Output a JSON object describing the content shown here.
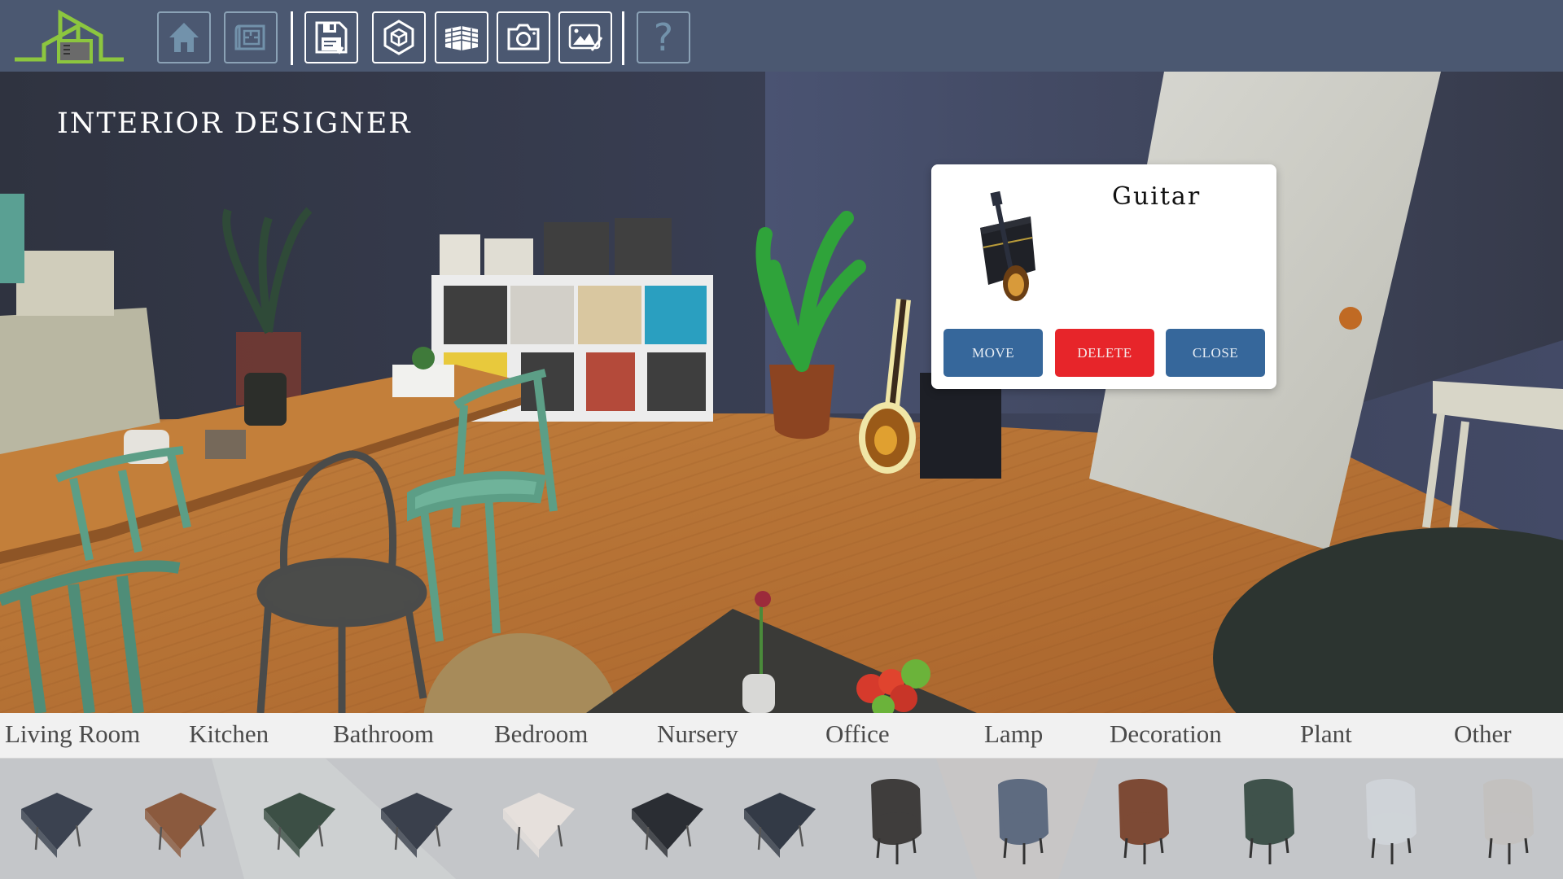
{
  "app": {
    "title": "INTERIOR DESIGNER",
    "logo": "house-logo-icon",
    "accent_color": "#8cc63f",
    "toolbar_color": "#4b5871"
  },
  "toolbar": {
    "buttons": [
      {
        "id": "home",
        "icon": "home-icon",
        "enabled": false
      },
      {
        "id": "floorplan",
        "icon": "blueprint-icon",
        "enabled": false
      },
      {
        "id": "save",
        "icon": "save-download-icon",
        "enabled": true
      },
      {
        "id": "3d-view",
        "icon": "cube-icon",
        "enabled": true
      },
      {
        "id": "walls",
        "icon": "brick-wall-icon",
        "enabled": true
      },
      {
        "id": "screenshot",
        "icon": "camera-icon",
        "enabled": true
      },
      {
        "id": "edit-image",
        "icon": "image-edit-icon",
        "enabled": true
      },
      {
        "id": "help",
        "icon": "help-icon",
        "enabled": false,
        "glyph": "?"
      }
    ]
  },
  "popup": {
    "item_name": "Guitar",
    "thumbnail": "guitar-amp-thumbnail",
    "buttons": {
      "move": "MOVE",
      "delete": "DELETE",
      "close": "CLOSE"
    },
    "colors": {
      "move": "#36679b",
      "delete": "#e7252a",
      "close": "#36679b"
    }
  },
  "categories": [
    {
      "label": "Living Room"
    },
    {
      "label": "Kitchen"
    },
    {
      "label": "Bathroom"
    },
    {
      "label": "Bedroom"
    },
    {
      "label": "Nursery"
    },
    {
      "label": "Office"
    },
    {
      "label": "Lamp"
    },
    {
      "label": "Decoration"
    },
    {
      "label": "Plant"
    },
    {
      "label": "Other"
    }
  ],
  "items": [
    {
      "name": "dark-leather-ottoman",
      "color": "#3b4250"
    },
    {
      "name": "brown-leather-pouf",
      "color": "#8b5a3e"
    },
    {
      "name": "green-footstool",
      "color": "#3c4f45"
    },
    {
      "name": "tufted-x-bench",
      "color": "#3a404c"
    },
    {
      "name": "white-tufted-pouf",
      "color": "#e6e0dc"
    },
    {
      "name": "black-bench-ottoman",
      "color": "#2a2d33"
    },
    {
      "name": "navy-square-ottoman",
      "color": "#333a46"
    },
    {
      "name": "dark-grey-lounge-chair",
      "color": "#3f3d3c"
    },
    {
      "name": "blue-wingback-chair",
      "color": "#5e6b80"
    },
    {
      "name": "brown-leather-chaise",
      "color": "#7d4a35"
    },
    {
      "name": "green-egg-chair",
      "color": "#3f524b"
    },
    {
      "name": "white-rattan-armchair",
      "color": "#cfd3d8"
    },
    {
      "name": "grey-tub-chair",
      "color": "#c3c1bf"
    }
  ]
}
